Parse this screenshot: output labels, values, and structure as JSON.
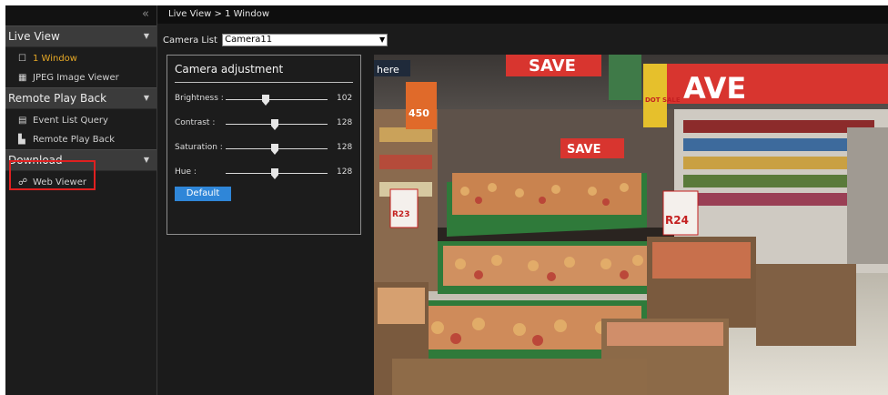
{
  "sidebar": {
    "collapse_glyph": "«",
    "sections": [
      {
        "label": "Live View",
        "items": [
          {
            "label": "1 Window",
            "icon": "window-icon",
            "active": true
          },
          {
            "label": "JPEG Image Viewer",
            "icon": "film-icon"
          }
        ]
      },
      {
        "label": "Remote Play Back",
        "items": [
          {
            "label": "Event List Query",
            "icon": "document-icon"
          },
          {
            "label": "Remote Play Back",
            "icon": "playback-icon"
          }
        ]
      },
      {
        "label": "Download",
        "items": [
          {
            "label": "Web Viewer",
            "icon": "web-viewer-icon"
          }
        ]
      }
    ]
  },
  "header": {
    "breadcrumb": "Live View > 1 Window"
  },
  "camera": {
    "label": "Camera List",
    "selected": "Camera11"
  },
  "adjust": {
    "title": "Camera adjustment",
    "sliders": [
      {
        "label": "Brightness :",
        "value": "102"
      },
      {
        "label": "Contrast :",
        "value": "128"
      },
      {
        "label": "Saturation :",
        "value": "128"
      },
      {
        "label": "Hue :",
        "value": "128"
      }
    ],
    "default_label": "Default"
  },
  "video": {
    "signs": {
      "here": "here",
      "save1": "SAVE",
      "save2": "SAVE",
      "save_big": "AVE",
      "save_small": "SAVE",
      "price1": "R23",
      "price2": "R24",
      "sign450": "450",
      "dot": "DOT SALE"
    }
  },
  "colors": {
    "accent": "#2f86d8",
    "active_item": "#e6a826",
    "highlight": "#e02020"
  }
}
